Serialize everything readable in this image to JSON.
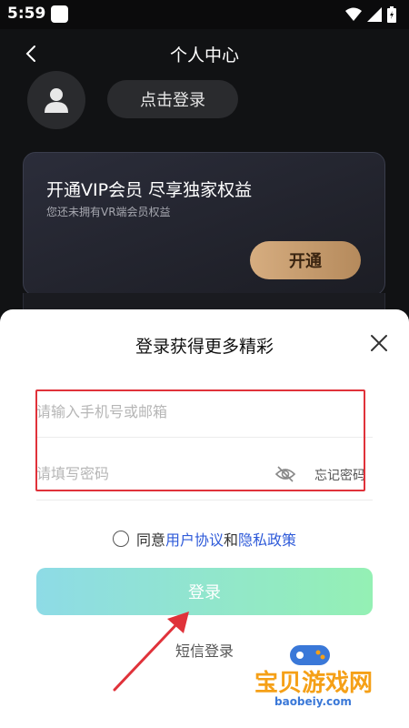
{
  "status_bar": {
    "time": "5:59"
  },
  "header": {
    "title": "个人中心"
  },
  "profile": {
    "login_label": "点击登录"
  },
  "vip_card": {
    "title": "开通VIP会员 尽享独家权益",
    "subtitle": "您还未拥有VR端会员权益",
    "button_label": "开通"
  },
  "login_sheet": {
    "title": "登录获得更多精彩",
    "phone_placeholder": "请输入手机号或邮箱",
    "password_placeholder": "请填写密码",
    "forgot_password": "忘记密码",
    "agree_prefix": "同意",
    "user_agreement": "用户协议",
    "agree_and": "和",
    "privacy_policy": "隐私政策",
    "login_button": "登录",
    "sms_login": "短信登录"
  },
  "watermark": {
    "name": "宝贝游戏网",
    "url": "baobeiy.com"
  },
  "colors": {
    "background": "#111214",
    "vip_gold": "#d6ad80",
    "link_blue": "#2f5bd9",
    "highlight_red": "#e0323a",
    "login_gradient_start": "#8edbe6",
    "login_gradient_end": "#94f0b4"
  },
  "icons": {
    "back": "chevron-left-icon",
    "avatar": "user-icon",
    "close": "close-icon",
    "password_visibility": "eye-off-icon"
  }
}
